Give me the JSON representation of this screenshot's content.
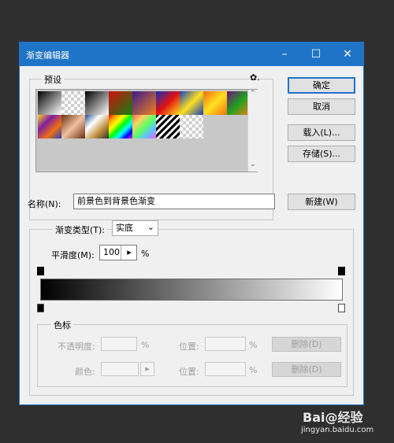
{
  "window": {
    "title": "渐变编辑器",
    "minimize": "–",
    "maximize": "☐",
    "close": "✕"
  },
  "presets": {
    "label": "预设",
    "gear": "✿.",
    "scroll_up": "⌃",
    "scroll_down": "⌄"
  },
  "buttons": {
    "ok": "确定",
    "cancel": "取消",
    "load": "载入(L)...",
    "save": "存储(S)...",
    "new": "新建(W)"
  },
  "name": {
    "label": "名称(N):",
    "value": "前景色到背景色渐变"
  },
  "gradient": {
    "type_label": "渐变类型(T):",
    "type_value": "实底",
    "type_arrow": "⌄",
    "smooth_label": "平滑度(M):",
    "smooth_value": "100",
    "smooth_arrow": "▸",
    "smooth_unit": "%"
  },
  "stops": {
    "label": "色标",
    "opacity_label": "不透明度:",
    "opacity_unit": "%",
    "position_label_1": "位置:",
    "position_unit_1": "%",
    "delete_1": "删除(D)",
    "color_label": "颜色:",
    "color_arrow": "▸",
    "position_label_2": "位置:",
    "position_unit_2": "%",
    "delete_2": "删除(D)"
  },
  "watermark": {
    "logo": "Bai@经验",
    "url": "jingyan.baidu.com"
  },
  "colors": {
    "titlebar": "#1f74c7",
    "dialog_bg": "#f0f0f0",
    "background": "#2f2f2f"
  }
}
